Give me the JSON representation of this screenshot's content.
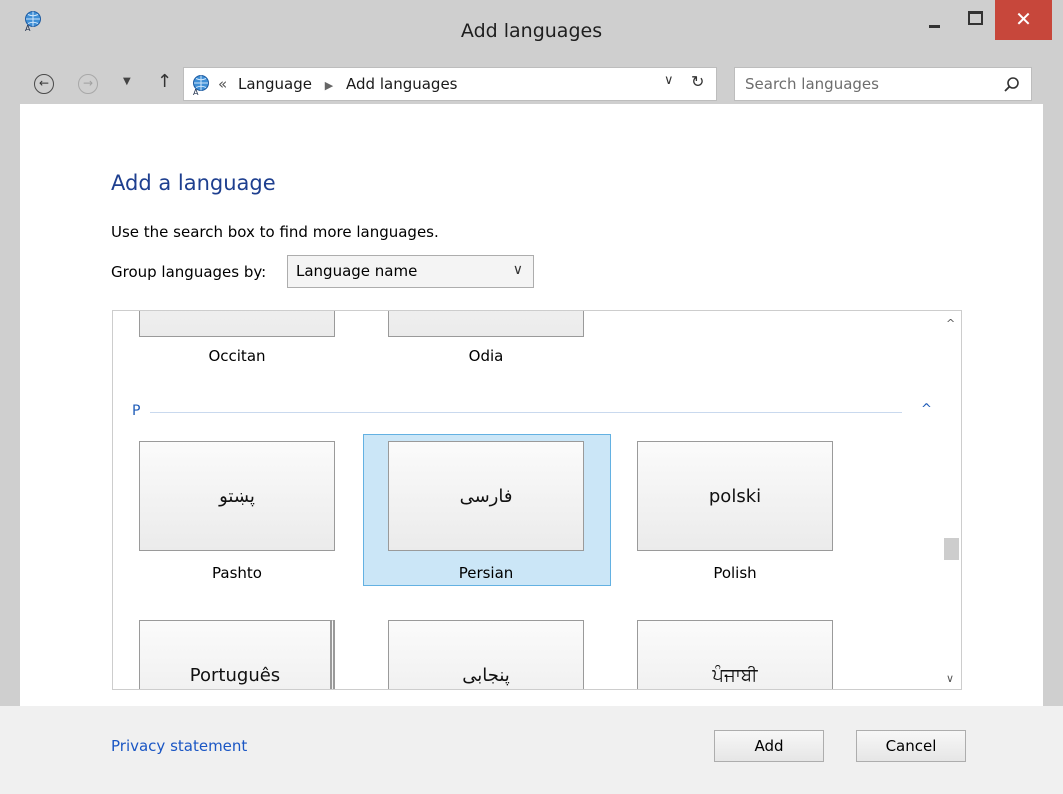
{
  "window": {
    "title": "Add languages",
    "close_glyph": "✕",
    "accent_close": "#c7473b"
  },
  "nav": {
    "back_glyph": "←",
    "forward_glyph": "→",
    "recent_glyph": "▼",
    "up_glyph": "↑",
    "breadcrumb_prefix": "«",
    "breadcrumbs": [
      "Language",
      "Add languages"
    ],
    "breadcrumb_sep": "▶",
    "address_dropdown_glyph": "∨",
    "refresh_glyph": "↻"
  },
  "search": {
    "placeholder": "Search languages",
    "icon": "search-icon"
  },
  "main": {
    "heading": "Add a language",
    "instruction": "Use the search box to find more languages.",
    "group_by_label": "Group languages by:",
    "group_by_value": "Language name",
    "group_by_chevron": "∨"
  },
  "sections": [
    {
      "letter": "P",
      "collapse_glyph": "^"
    }
  ],
  "tiles": [
    {
      "native": "",
      "label": "Occitan"
    },
    {
      "native": "",
      "label": "Odia"
    },
    {
      "native": "پښتو",
      "label": "Pashto"
    },
    {
      "native": "فارسی",
      "label": "Persian",
      "selected": true
    },
    {
      "native": "polski",
      "label": "Polish"
    },
    {
      "native": "Português",
      "label": ""
    },
    {
      "native": "پنجابی",
      "label": ""
    },
    {
      "native": "ਪੰਜਾਬੀ",
      "label": ""
    }
  ],
  "scroll": {
    "up_glyph": "^",
    "down_glyph": "∨",
    "position": 0.62
  },
  "footer": {
    "privacy": "Privacy statement",
    "add": "Add",
    "cancel": "Cancel"
  }
}
